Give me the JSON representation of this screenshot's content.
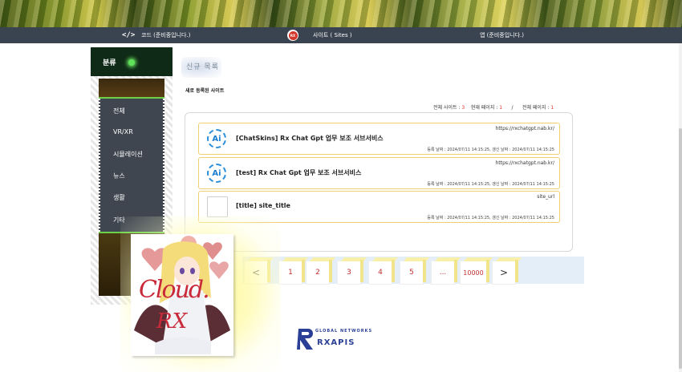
{
  "nav": {
    "code_icon": "</>",
    "code_label": "코드 (준비중입니다.)",
    "sites_icon": "RX",
    "sites_label": "사이트 ( Sites )",
    "app_label": "앱 (준비중입니다.)"
  },
  "sidebar": {
    "title": "분류",
    "items": [
      {
        "label": "전체"
      },
      {
        "label": "VR/XR"
      },
      {
        "label": "시뮬레이션"
      },
      {
        "label": "뉴스"
      },
      {
        "label": "생활"
      },
      {
        "label": "기타"
      }
    ]
  },
  "main": {
    "heading": "신규 목록",
    "subheading": "새로 등록된 사이트",
    "counts": {
      "total_label": "전체 사이트 :",
      "total_value": "3",
      "current_label": "현재 페이지 :",
      "current_value": "1",
      "separator": "/",
      "pages_label": "전체 페이지 :",
      "pages_value": "1"
    },
    "sites": [
      {
        "icon": "Ai",
        "title": "[ChatSkins] Rx Chat Gpt 업무 보조 서브서비스",
        "url": "https://rxchatgpt.nab.kr/",
        "dates": "등록 날짜 : 2024/07/11 14:15:25, 갱신 날짜 : 2024/07/11 14:15:25"
      },
      {
        "icon": "Ai",
        "title": "[test] Rx Chat Gpt 업무 보조 서브서비스",
        "url": "https://rxchatgpt.nab.kr/",
        "dates": "등록 날짜 : 2024/07/11 14:15:25, 갱신 날짜 : 2024/07/11 14:15:25"
      },
      {
        "icon": "",
        "title": "[title] site_title",
        "url": "site_url",
        "dates": "등록 날짜 : 2024/07/11 14:15:25, 갱신 날짜 : 2024/07/11 14:15:25"
      }
    ]
  },
  "pagination": {
    "prev": "<",
    "pages": [
      "1",
      "2",
      "3",
      "4",
      "5",
      "...",
      "10000"
    ],
    "next": ">"
  },
  "poster": {
    "line1": "Cloud.",
    "line2": "RX"
  },
  "footer": {
    "logo_small": "GLOBAL NETWORKS",
    "logo_big": "RXAPIS"
  },
  "colors": {
    "navbar": "#3a4350",
    "accent_green": "#6cd14a",
    "count_red": "#e0302c",
    "card_border": "#f0d070",
    "logo_blue": "#2a3f95"
  }
}
